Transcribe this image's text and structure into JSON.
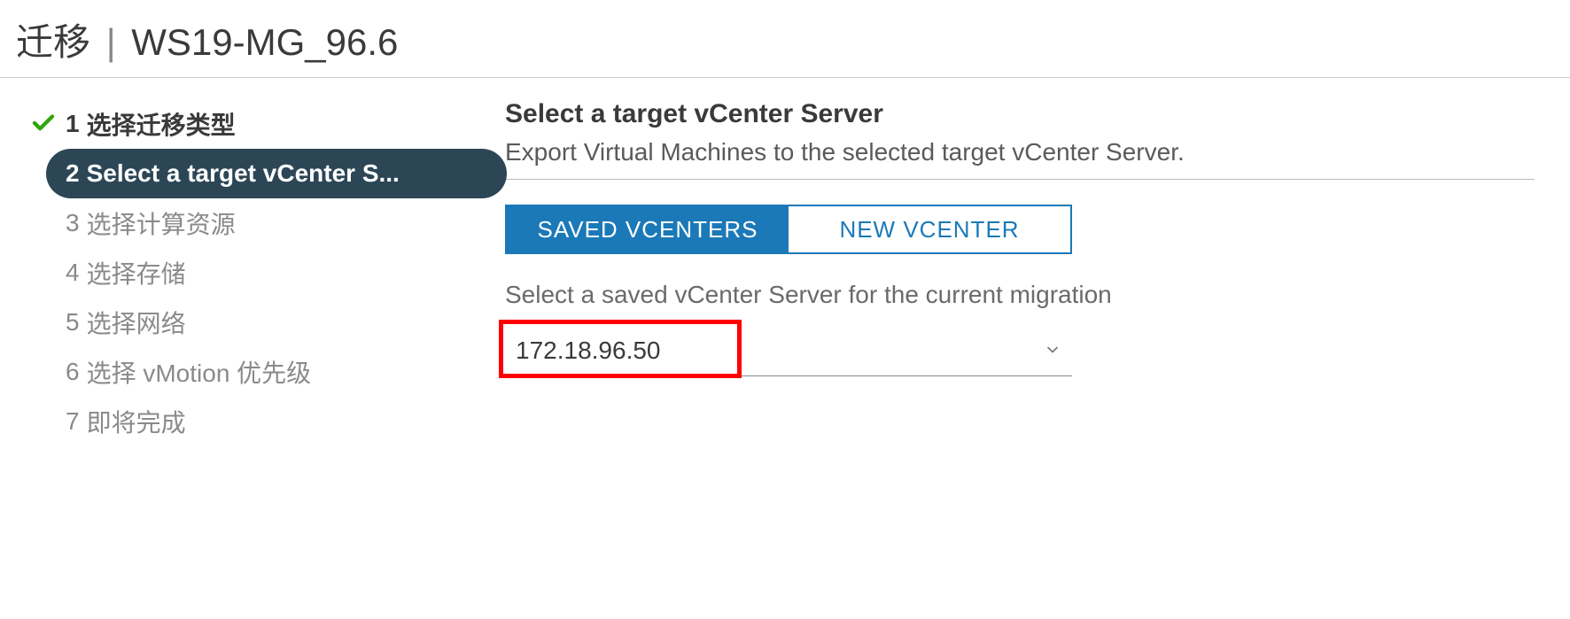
{
  "header": {
    "title_prefix": "迁移",
    "title_suffix": "WS19-MG_96.6"
  },
  "steps": [
    {
      "num": "1",
      "label": "选择迁移类型",
      "state": "completed"
    },
    {
      "num": "2",
      "label": "Select a target vCenter S...",
      "state": "active"
    },
    {
      "num": "3",
      "label": "选择计算资源",
      "state": "pending"
    },
    {
      "num": "4",
      "label": "选择存储",
      "state": "pending"
    },
    {
      "num": "5",
      "label": "选择网络",
      "state": "pending"
    },
    {
      "num": "6",
      "label": "选择 vMotion 优先级",
      "state": "pending"
    },
    {
      "num": "7",
      "label": "即将完成",
      "state": "pending"
    }
  ],
  "main": {
    "heading": "Select a target vCenter Server",
    "desc": "Export Virtual Machines to the selected target vCenter Server.",
    "tabs": {
      "saved": "SAVED VCENTERS",
      "new": "NEW VCENTER",
      "active": "saved"
    },
    "hint": "Select a saved vCenter Server for the current migration",
    "dropdown": {
      "value": "172.18.96.50"
    }
  }
}
